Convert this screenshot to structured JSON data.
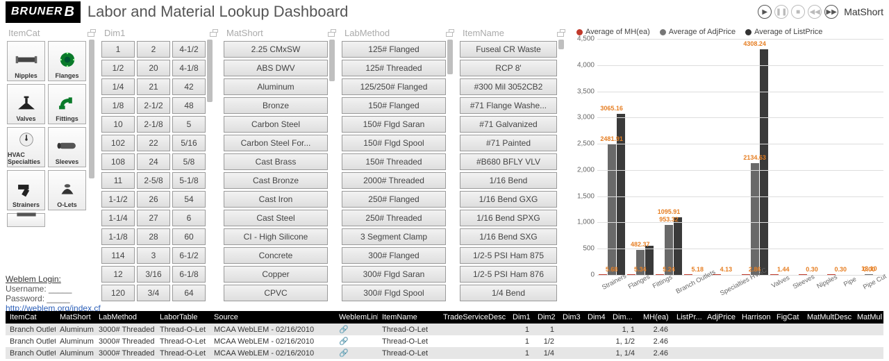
{
  "header": {
    "logo_text": "BRUNER",
    "title": "Labor and Material Lookup Dashboard",
    "playback_label": "MatShort"
  },
  "slicers": {
    "itemcat": {
      "title": "ItemCat",
      "items": [
        {
          "label": "Nipples"
        },
        {
          "label": "Flanges"
        },
        {
          "label": "Valves"
        },
        {
          "label": "Fittings"
        },
        {
          "label": "HVAC Specialties"
        },
        {
          "label": "Sleeves"
        },
        {
          "label": "Strainers"
        },
        {
          "label": "O-Lets"
        }
      ]
    },
    "dim1": {
      "title": "Dim1",
      "rows": [
        [
          "1",
          "2",
          "4-1/2"
        ],
        [
          "1/2",
          "20",
          "4-1/8"
        ],
        [
          "1/4",
          "21",
          "42"
        ],
        [
          "1/8",
          "2-1/2",
          "48"
        ],
        [
          "10",
          "2-1/8",
          "5"
        ],
        [
          "102",
          "22",
          "5/16"
        ],
        [
          "108",
          "24",
          "5/8"
        ],
        [
          "11",
          "2-5/8",
          "5-1/8"
        ],
        [
          "1-1/2",
          "26",
          "54"
        ],
        [
          "1-1/4",
          "27",
          "6"
        ],
        [
          "1-1/8",
          "28",
          "60"
        ],
        [
          "114",
          "3",
          "6-1/2"
        ],
        [
          "12",
          "3/16",
          "6-1/8"
        ],
        [
          "120",
          "3/4",
          "64"
        ]
      ]
    },
    "matshort": {
      "title": "MatShort",
      "items": [
        "2.25 CMxSW",
        "ABS DWV",
        "Aluminum",
        "Bronze",
        "Carbon Steel",
        "Carbon Steel For...",
        "Cast Brass",
        "Cast Bronze",
        "Cast Iron",
        "Cast Steel",
        "CI - High Silicone",
        "Concrete",
        "Copper",
        "CPVC"
      ]
    },
    "labmethod": {
      "title": "LabMethod",
      "items": [
        "125# Flanged",
        "125# Threaded",
        "125/250# Flanged",
        "150# Flanged",
        "150# Flgd Saran",
        "150# Flgd Spool",
        "150# Threaded",
        "2000# Threaded",
        "250# Flanged",
        "250# Threaded",
        "3 Segment Clamp",
        "300# Flanged",
        "300# Flgd Saran",
        "300# Flgd Spool"
      ]
    },
    "itemname": {
      "title": "ItemName",
      "items": [
        "Fuseal CR Waste",
        "RCP 8'",
        "#300 Mil 3052CB2",
        "#71 Flange Washe...",
        "#71 Galvanized",
        "#71 Painted",
        "#B680 BFLY VLV",
        "1/16 Bend",
        "1/16 Bend GXG",
        "1/16 Bend SPXG",
        "1/16 Bend SXG",
        "1/2-5 PSI Ham 875",
        "1/2-5 PSI Ham 876",
        "1/4 Bend"
      ]
    }
  },
  "weblem": {
    "title": "Weblem Login:",
    "user_label": "Username:",
    "pass_label": "Password:",
    "url_text": "http://weblem.org/index.cfm"
  },
  "chart_data": {
    "type": "bar",
    "legend": [
      {
        "name": "Average of MH(ea)",
        "color": "#c0392b"
      },
      {
        "name": "Average of AdjPrice",
        "color": "#777"
      },
      {
        "name": "Average of ListPrice",
        "color": "#333"
      }
    ],
    "ylim": [
      0,
      4500
    ],
    "yticks": [
      0,
      500,
      1000,
      1500,
      2000,
      2500,
      3000,
      3500,
      4000,
      4500
    ],
    "categories": [
      "Strainers",
      "Flanges",
      "Fittings",
      "Branch Outlets",
      "Specialties HVAC",
      "Valves",
      "Sleeves",
      "Nipples",
      "Pipe",
      "Pipe Cut"
    ],
    "series": [
      {
        "name": "Average of MH(ea)",
        "values": [
          5.68,
          5.34,
          5.24,
          5.18,
          4.13,
          2.86,
          1.44,
          0.3,
          0.3,
          0.0
        ]
      },
      {
        "name": "Average of AdjPrice",
        "values": [
          2481.91,
          482.37,
          953.32,
          null,
          null,
          2134.63,
          null,
          null,
          null,
          13.1
        ]
      },
      {
        "name": "Average of ListPrice",
        "values": [
          3065.16,
          560,
          1095.91,
          null,
          null,
          4308.24,
          null,
          null,
          null,
          null
        ]
      }
    ],
    "value_labels": [
      {
        "cat": 0,
        "text": "5.68",
        "y": 5.68
      },
      {
        "cat": 0,
        "text": "2481.91",
        "y": 2481.91
      },
      {
        "cat": 0,
        "text": "3065.16",
        "y": 3065.16
      },
      {
        "cat": 1,
        "text": "5.34",
        "y": 5.34
      },
      {
        "cat": 1,
        "text": "482.37",
        "y": 482.37
      },
      {
        "cat": 2,
        "text": "5.24",
        "y": 5.24
      },
      {
        "cat": 2,
        "text": "953.32",
        "y": 953.32
      },
      {
        "cat": 2,
        "text": "1095.91",
        "y": 1095.91
      },
      {
        "cat": 3,
        "text": "5.18",
        "y": 5.18
      },
      {
        "cat": 4,
        "text": "4.13",
        "y": 4.13
      },
      {
        "cat": 5,
        "text": "2.86",
        "y": 2.86
      },
      {
        "cat": 5,
        "text": "2134.63",
        "y": 2134.63
      },
      {
        "cat": 5,
        "text": "4308.24",
        "y": 4308.24
      },
      {
        "cat": 6,
        "text": "1.44",
        "y": 1.44
      },
      {
        "cat": 7,
        "text": "0.30",
        "y": 0.3
      },
      {
        "cat": 8,
        "text": "0.30",
        "y": 0.3
      },
      {
        "cat": 9,
        "text": "0.00",
        "y": 0.0
      },
      {
        "cat": 9,
        "text": "13.10",
        "y": 13.1
      }
    ]
  },
  "table": {
    "columns": [
      "ItemCat",
      "MatShort",
      "LabMethod",
      "LaborTable",
      "Source",
      "WeblemLink",
      "ItemName",
      "TradeServiceDesc",
      "Dim1",
      "Dim2",
      "Dim3",
      "Dim4",
      "Dim...",
      "MH(ea)",
      "ListPr...",
      "AdjPrice",
      "Harrison",
      "FigCat",
      "MatMultDesc",
      "MatMul"
    ],
    "widths": [
      72,
      56,
      88,
      78,
      180,
      62,
      88,
      100,
      36,
      36,
      36,
      36,
      44,
      48,
      44,
      50,
      50,
      44,
      72,
      44
    ],
    "rows": [
      [
        "Branch Outlets",
        "Aluminum",
        "3000# Threaded",
        "Thread-O-Let",
        "MCAA WebLEM - 02/16/2010",
        "link",
        "Thread-O-Let",
        "",
        "1",
        "1",
        "",
        "",
        "1, 1",
        "2.46",
        "",
        "",
        "",
        "",
        "",
        ""
      ],
      [
        "Branch Outlets",
        "Aluminum",
        "3000# Threaded",
        "Thread-O-Let",
        "MCAA WebLEM - 02/16/2010",
        "link",
        "Thread-O-Let",
        "",
        "1",
        "1/2",
        "",
        "",
        "1, 1/2",
        "2.46",
        "",
        "",
        "",
        "",
        "",
        ""
      ],
      [
        "Branch Outlets",
        "Aluminum",
        "3000# Threaded",
        "Thread-O-Let",
        "MCAA WebLEM - 02/16/2010",
        "link",
        "Thread-O-Let",
        "",
        "1",
        "1/4",
        "",
        "",
        "1, 1/4",
        "2.46",
        "",
        "",
        "",
        "",
        "",
        ""
      ]
    ]
  }
}
